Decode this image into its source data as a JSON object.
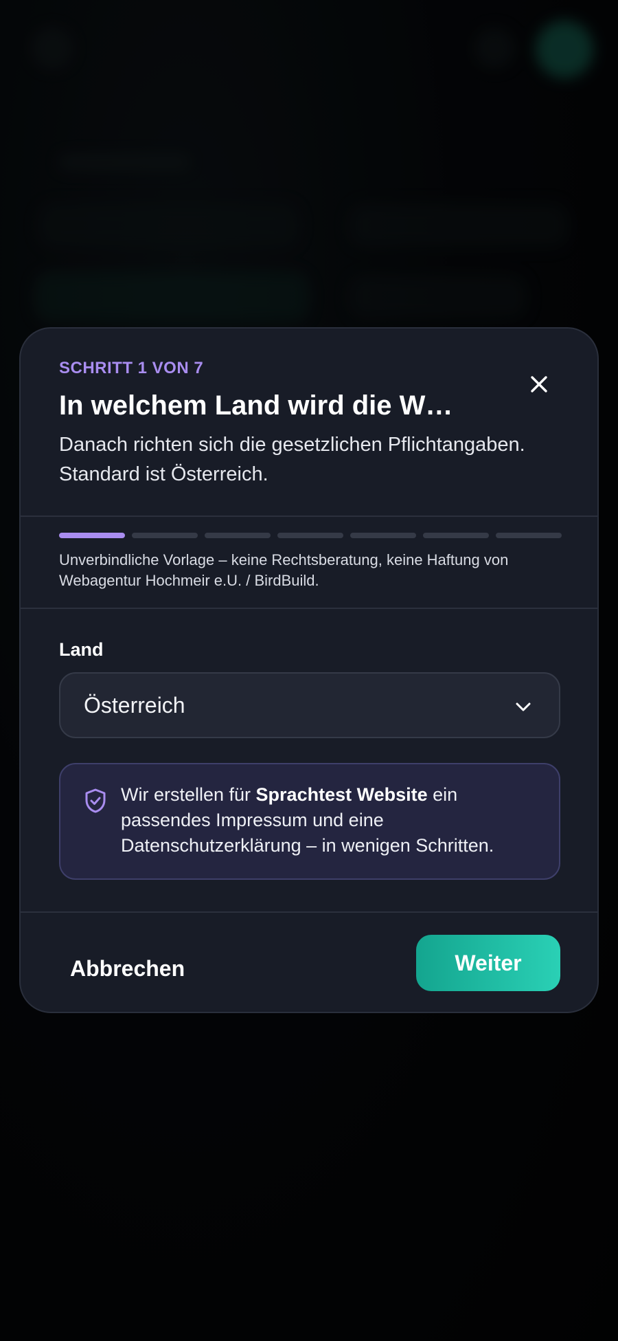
{
  "dialog": {
    "step_label": "SCHRITT 1 VON 7",
    "title": "In welchem Land wird die W…",
    "subtitle": "Danach richten sich die gesetzlichen Pflichtangaben. Standard ist Österreich.",
    "progress": {
      "current": 1,
      "total": 7
    },
    "disclaimer": "Unverbindliche Vorlage – keine Rechtsberatung, keine Haftung von Webagentur Hochmeir e.U. / BirdBuild.",
    "close_icon": "close-icon",
    "accent_color": "#a98df0",
    "primary_color": "#1fbca3"
  },
  "form": {
    "country_label": "Land",
    "country_value": "Österreich",
    "select_icon": "chevron-down-icon"
  },
  "info": {
    "icon": "shield-check-icon",
    "text_before": "Wir erstellen für ",
    "site_name": "Sprachtest Website",
    "text_after": " ein passendes Impressum und eine Datenschutzerklärung – in wenigen Schritten."
  },
  "footer": {
    "cancel_label": "Abbrechen",
    "next_label": "Weiter"
  }
}
